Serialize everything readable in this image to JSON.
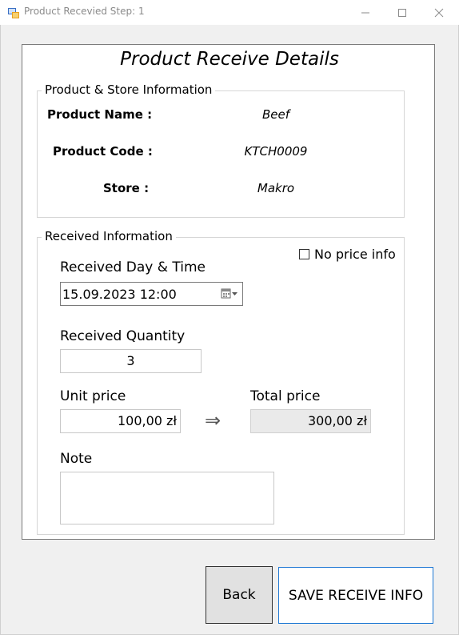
{
  "window": {
    "title": "Product Recevied Step: 1",
    "icon": "app-window-icon",
    "controls": [
      "minimize-icon",
      "maximize-icon",
      "close-icon"
    ]
  },
  "form": {
    "title": "Product Receive Details"
  },
  "product_group": {
    "legend": "Product & Store Information",
    "name_label": "Product Name :",
    "name_value": "Beef",
    "code_label": "Product Code :",
    "code_value": "KTCH0009",
    "store_label": "Store :",
    "store_value": "Makro"
  },
  "received_group": {
    "legend": "Received Information",
    "no_price_label": "No price info",
    "no_price_checked": false,
    "datetime_label": "Received Day & Time",
    "datetime_value": "15.09.2023 12:00",
    "quantity_label": "Received Quantity",
    "quantity_value": "3",
    "unit_price_label": "Unit price",
    "unit_price_value": "100,00 zł",
    "arrow_glyph": "⇒",
    "total_price_label": "Total price",
    "total_price_value": "300,00 zł",
    "note_label": "Note",
    "note_value": ""
  },
  "buttons": {
    "back": "Back",
    "save": "SAVE RECEIVE INFO"
  },
  "colors": {
    "accent_border": "#1e78d4",
    "disabled_field": "#eaeaea",
    "panel": "#ffffff",
    "window_bg": "#f0f0f0"
  }
}
